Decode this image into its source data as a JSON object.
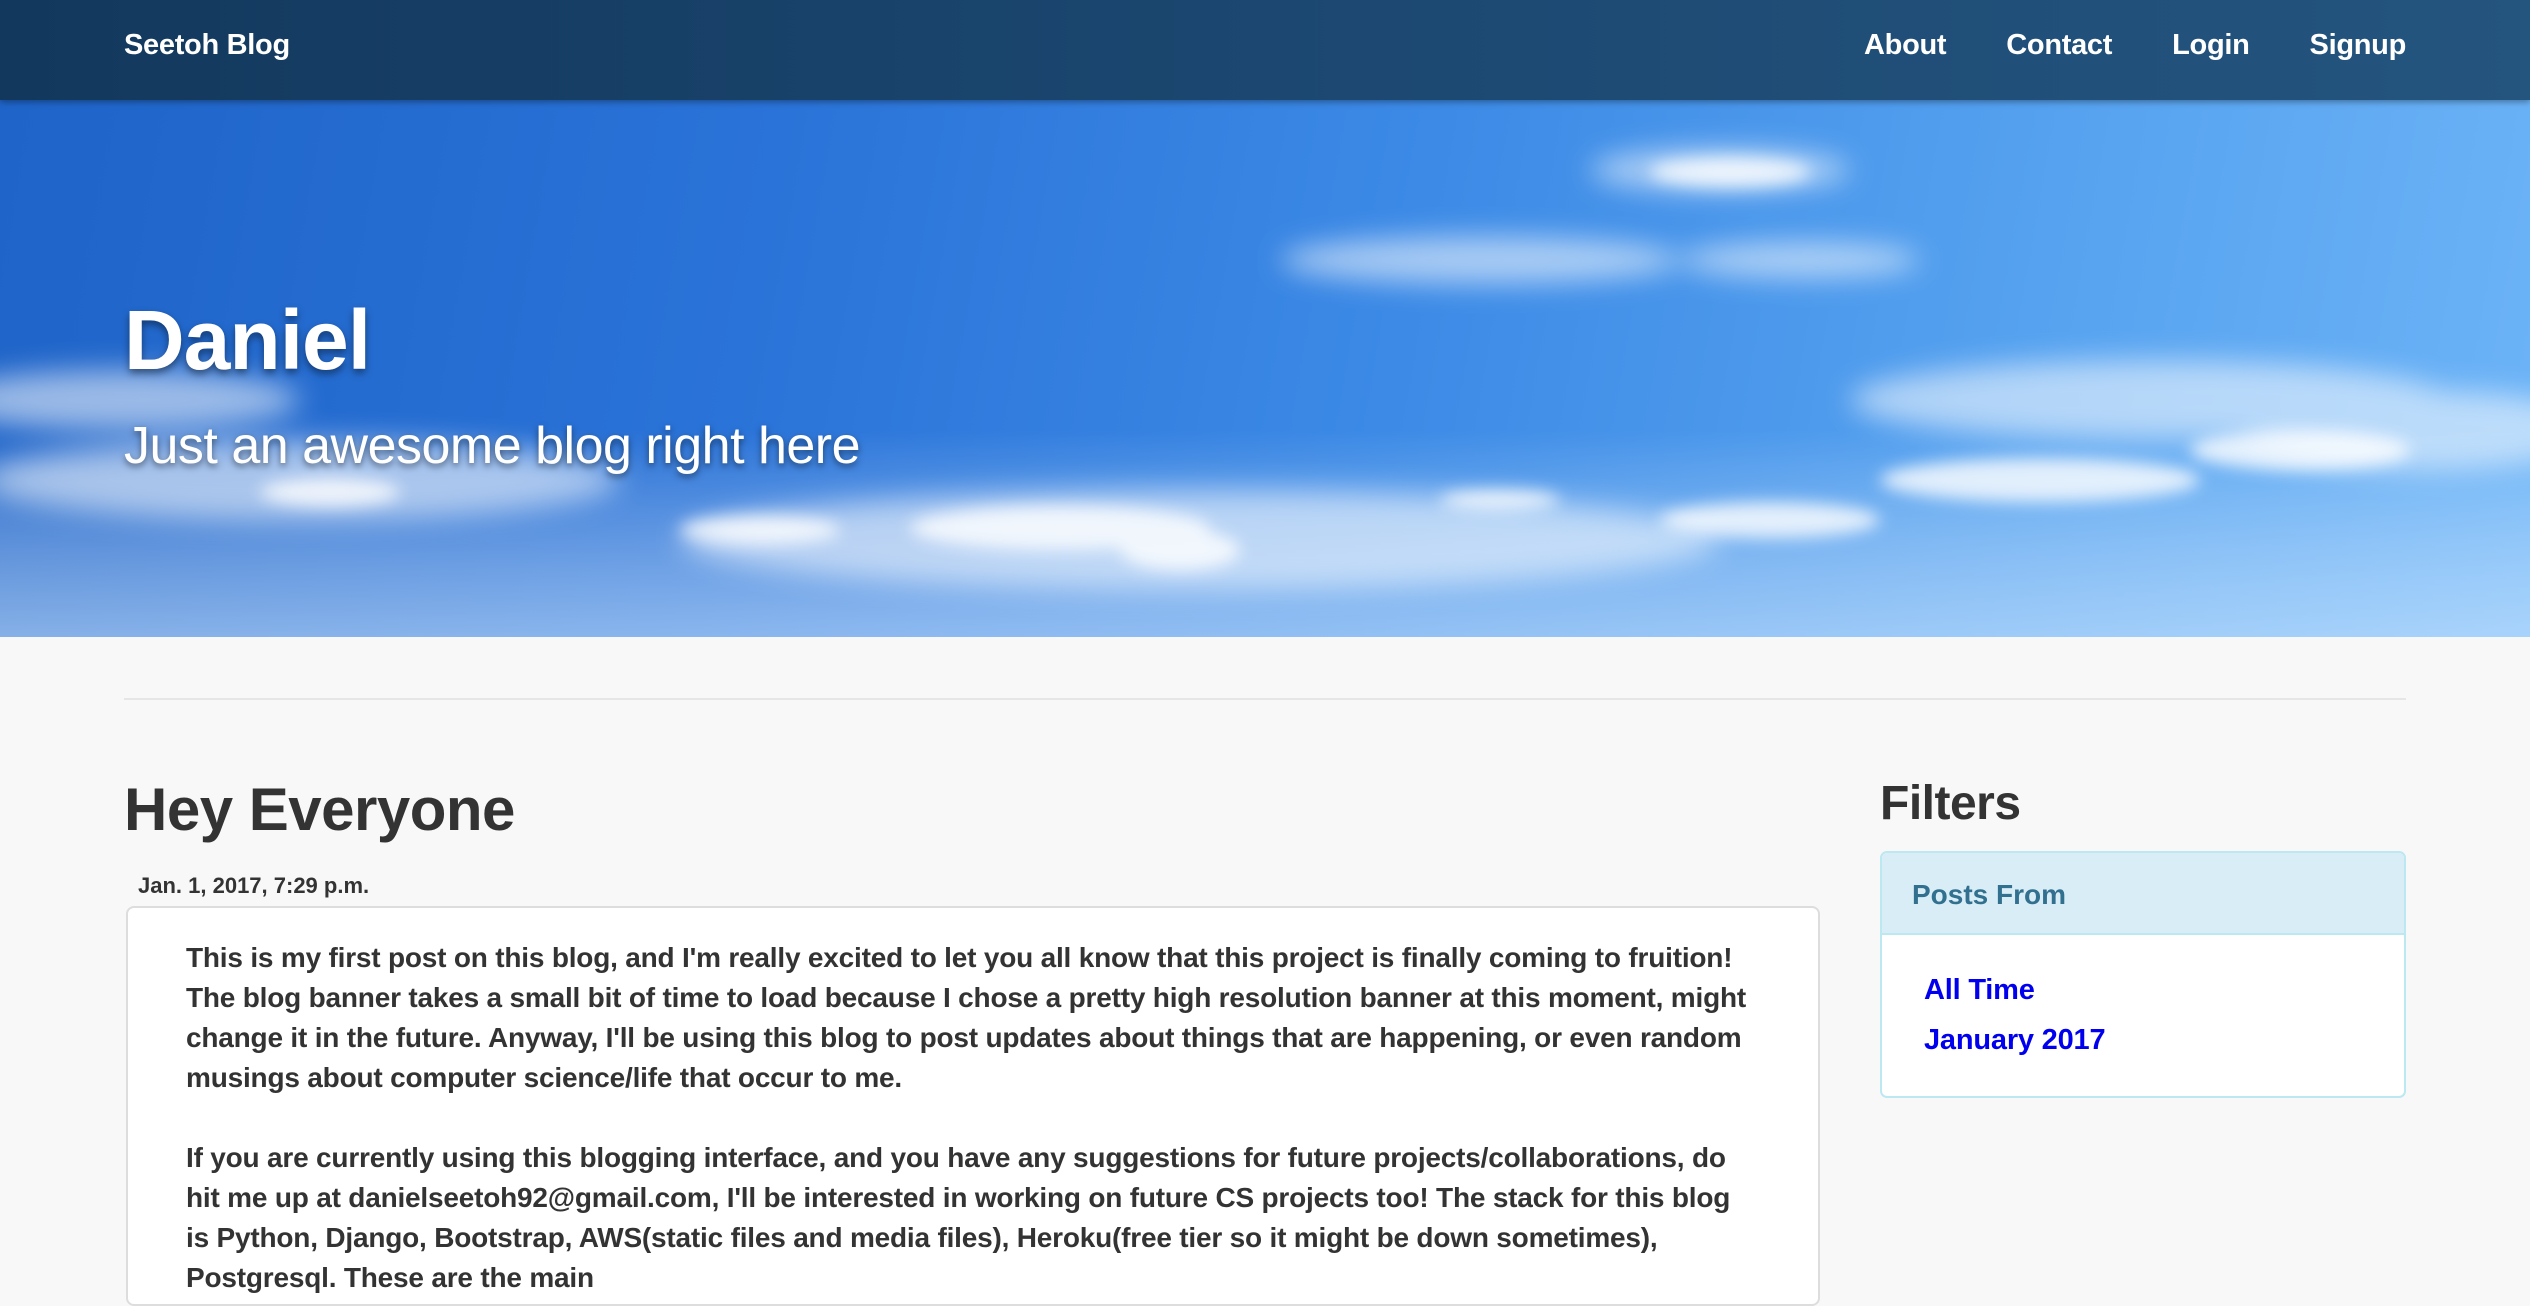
{
  "navbar": {
    "brand": "Seetoh Blog",
    "links": [
      "About",
      "Contact",
      "Login",
      "Signup"
    ]
  },
  "hero": {
    "title": "Daniel",
    "subtitle": "Just an awesome blog right here"
  },
  "post": {
    "title": "Hey Everyone",
    "date": "Jan. 1, 2017, 7:29 p.m.",
    "paragraphs": [
      "This is my first post on this blog, and I'm really excited to let you all know that this project is finally coming to fruition! The blog banner takes a small bit of time to load because I chose a pretty high resolution banner at this moment, might change it in the future. Anyway, I'll be using this blog to post updates about things that are happening, or even random musings about computer science/life that occur to me.",
      "If you are currently using this blogging interface, and you have any suggestions for future projects/collaborations, do hit me up at danielseetoh92@gmail.com, I'll be interested in working on future CS projects too! The stack for this blog is Python, Django, Bootstrap, AWS(static files and media files), Heroku(free tier so it might be down sometimes), Postgresql. These are the main"
    ]
  },
  "sidebar": {
    "title": "Filters",
    "panel_heading": "Posts From",
    "items": [
      "All Time",
      "January 2017"
    ]
  },
  "colors": {
    "navbar": "#1b4770",
    "sky": "#2a73d8",
    "panel_heading_bg": "#d9edf7",
    "panel_heading_text": "#31708f",
    "link": "#0000ee"
  }
}
